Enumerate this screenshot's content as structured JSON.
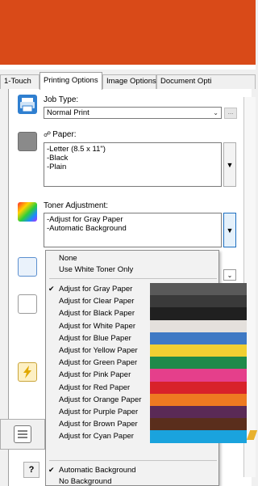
{
  "tabs": [
    {
      "label": "1-Touch"
    },
    {
      "label": "Printing Options"
    },
    {
      "label": "Image Options"
    },
    {
      "label": "Document Opti"
    }
  ],
  "job_type": {
    "label": "Job Type:",
    "value": "Normal Print",
    "more": "..."
  },
  "paper": {
    "label": "Paper:",
    "lines": [
      "-Letter (8.5 x 11\")",
      "-Black",
      "-Plain"
    ]
  },
  "toner": {
    "label": "Toner Adjustment:",
    "lines": [
      "-Adjust for Gray Paper",
      "-Automatic Background"
    ]
  },
  "menu": {
    "top_items": [
      "None",
      "Use White Toner Only"
    ],
    "paper_items": [
      {
        "label": "Adjust for Gray Paper",
        "checked": true,
        "swatch": "#595959"
      },
      {
        "label": "Adjust for Clear Paper",
        "checked": false,
        "swatch": "#3a3a3a"
      },
      {
        "label": "Adjust for Black Paper",
        "checked": false,
        "swatch": "#202020"
      },
      {
        "label": "Adjust for White Paper",
        "checked": false,
        "swatch": "#e4e0dc"
      },
      {
        "label": "Adjust for Blue Paper",
        "checked": false,
        "swatch": "#3e79c4"
      },
      {
        "label": "Adjust for Yellow Paper",
        "checked": false,
        "swatch": "#f1cf32"
      },
      {
        "label": "Adjust for Green Paper",
        "checked": false,
        "swatch": "#1f8a4a"
      },
      {
        "label": "Adjust for Pink Paper",
        "checked": false,
        "swatch": "#e53f8b"
      },
      {
        "label": "Adjust for Red Paper",
        "checked": false,
        "swatch": "#d8222a"
      },
      {
        "label": "Adjust for Orange Paper",
        "checked": false,
        "swatch": "#ee7a21"
      },
      {
        "label": "Adjust for Purple Paper",
        "checked": false,
        "swatch": "#5a2a56"
      },
      {
        "label": "Adjust for Brown Paper",
        "checked": false,
        "swatch": "#5a2e1c"
      },
      {
        "label": "Adjust for Cyan Paper",
        "checked": false,
        "swatch": "#1aa3dd"
      }
    ],
    "bottom_items": [
      {
        "label": "Automatic Background",
        "checked": true
      },
      {
        "label": "No Background",
        "checked": false
      }
    ]
  },
  "colors": {
    "banner": "#d94a18",
    "accent": "#1e6fc0"
  },
  "help_label": "?"
}
